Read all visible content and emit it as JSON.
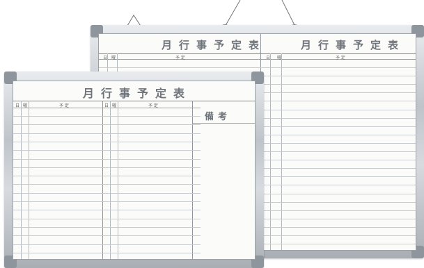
{
  "back_board": {
    "title_left": "月行事予定表",
    "title_right": "月行事予定表",
    "header_day": "日",
    "header_weekday": "曜",
    "header_schedule": "予 定"
  },
  "front_board": {
    "title": "月行事予定表",
    "header_day": "日",
    "header_weekday": "曜",
    "header_schedule": "予 定",
    "remarks": "備考"
  },
  "colors": {
    "frame": "#c3c8ce",
    "face": "#fbfbf9",
    "title": "#6e747a",
    "grid": "#c7cbcf"
  }
}
